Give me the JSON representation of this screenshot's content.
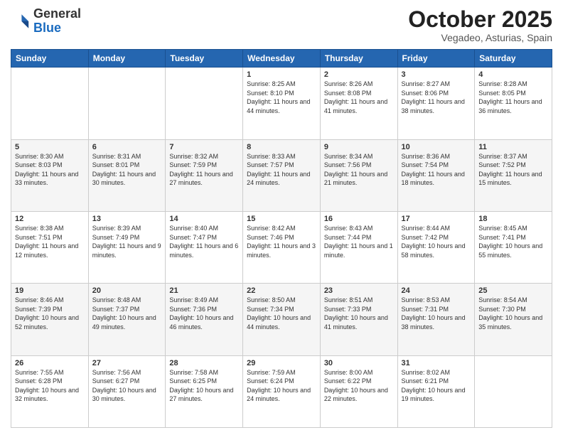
{
  "logo": {
    "general": "General",
    "blue": "Blue"
  },
  "header": {
    "month": "October 2025",
    "location": "Vegadeo, Asturias, Spain"
  },
  "days_of_week": [
    "Sunday",
    "Monday",
    "Tuesday",
    "Wednesday",
    "Thursday",
    "Friday",
    "Saturday"
  ],
  "weeks": [
    [
      {
        "day": "",
        "info": ""
      },
      {
        "day": "",
        "info": ""
      },
      {
        "day": "",
        "info": ""
      },
      {
        "day": "1",
        "info": "Sunrise: 8:25 AM\nSunset: 8:10 PM\nDaylight: 11 hours and 44 minutes."
      },
      {
        "day": "2",
        "info": "Sunrise: 8:26 AM\nSunset: 8:08 PM\nDaylight: 11 hours and 41 minutes."
      },
      {
        "day": "3",
        "info": "Sunrise: 8:27 AM\nSunset: 8:06 PM\nDaylight: 11 hours and 38 minutes."
      },
      {
        "day": "4",
        "info": "Sunrise: 8:28 AM\nSunset: 8:05 PM\nDaylight: 11 hours and 36 minutes."
      }
    ],
    [
      {
        "day": "5",
        "info": "Sunrise: 8:30 AM\nSunset: 8:03 PM\nDaylight: 11 hours and 33 minutes."
      },
      {
        "day": "6",
        "info": "Sunrise: 8:31 AM\nSunset: 8:01 PM\nDaylight: 11 hours and 30 minutes."
      },
      {
        "day": "7",
        "info": "Sunrise: 8:32 AM\nSunset: 7:59 PM\nDaylight: 11 hours and 27 minutes."
      },
      {
        "day": "8",
        "info": "Sunrise: 8:33 AM\nSunset: 7:57 PM\nDaylight: 11 hours and 24 minutes."
      },
      {
        "day": "9",
        "info": "Sunrise: 8:34 AM\nSunset: 7:56 PM\nDaylight: 11 hours and 21 minutes."
      },
      {
        "day": "10",
        "info": "Sunrise: 8:36 AM\nSunset: 7:54 PM\nDaylight: 11 hours and 18 minutes."
      },
      {
        "day": "11",
        "info": "Sunrise: 8:37 AM\nSunset: 7:52 PM\nDaylight: 11 hours and 15 minutes."
      }
    ],
    [
      {
        "day": "12",
        "info": "Sunrise: 8:38 AM\nSunset: 7:51 PM\nDaylight: 11 hours and 12 minutes."
      },
      {
        "day": "13",
        "info": "Sunrise: 8:39 AM\nSunset: 7:49 PM\nDaylight: 11 hours and 9 minutes."
      },
      {
        "day": "14",
        "info": "Sunrise: 8:40 AM\nSunset: 7:47 PM\nDaylight: 11 hours and 6 minutes."
      },
      {
        "day": "15",
        "info": "Sunrise: 8:42 AM\nSunset: 7:46 PM\nDaylight: 11 hours and 3 minutes."
      },
      {
        "day": "16",
        "info": "Sunrise: 8:43 AM\nSunset: 7:44 PM\nDaylight: 11 hours and 1 minute."
      },
      {
        "day": "17",
        "info": "Sunrise: 8:44 AM\nSunset: 7:42 PM\nDaylight: 10 hours and 58 minutes."
      },
      {
        "day": "18",
        "info": "Sunrise: 8:45 AM\nSunset: 7:41 PM\nDaylight: 10 hours and 55 minutes."
      }
    ],
    [
      {
        "day": "19",
        "info": "Sunrise: 8:46 AM\nSunset: 7:39 PM\nDaylight: 10 hours and 52 minutes."
      },
      {
        "day": "20",
        "info": "Sunrise: 8:48 AM\nSunset: 7:37 PM\nDaylight: 10 hours and 49 minutes."
      },
      {
        "day": "21",
        "info": "Sunrise: 8:49 AM\nSunset: 7:36 PM\nDaylight: 10 hours and 46 minutes."
      },
      {
        "day": "22",
        "info": "Sunrise: 8:50 AM\nSunset: 7:34 PM\nDaylight: 10 hours and 44 minutes."
      },
      {
        "day": "23",
        "info": "Sunrise: 8:51 AM\nSunset: 7:33 PM\nDaylight: 10 hours and 41 minutes."
      },
      {
        "day": "24",
        "info": "Sunrise: 8:53 AM\nSunset: 7:31 PM\nDaylight: 10 hours and 38 minutes."
      },
      {
        "day": "25",
        "info": "Sunrise: 8:54 AM\nSunset: 7:30 PM\nDaylight: 10 hours and 35 minutes."
      }
    ],
    [
      {
        "day": "26",
        "info": "Sunrise: 7:55 AM\nSunset: 6:28 PM\nDaylight: 10 hours and 32 minutes."
      },
      {
        "day": "27",
        "info": "Sunrise: 7:56 AM\nSunset: 6:27 PM\nDaylight: 10 hours and 30 minutes."
      },
      {
        "day": "28",
        "info": "Sunrise: 7:58 AM\nSunset: 6:25 PM\nDaylight: 10 hours and 27 minutes."
      },
      {
        "day": "29",
        "info": "Sunrise: 7:59 AM\nSunset: 6:24 PM\nDaylight: 10 hours and 24 minutes."
      },
      {
        "day": "30",
        "info": "Sunrise: 8:00 AM\nSunset: 6:22 PM\nDaylight: 10 hours and 22 minutes."
      },
      {
        "day": "31",
        "info": "Sunrise: 8:02 AM\nSunset: 6:21 PM\nDaylight: 10 hours and 19 minutes."
      },
      {
        "day": "",
        "info": ""
      }
    ]
  ]
}
